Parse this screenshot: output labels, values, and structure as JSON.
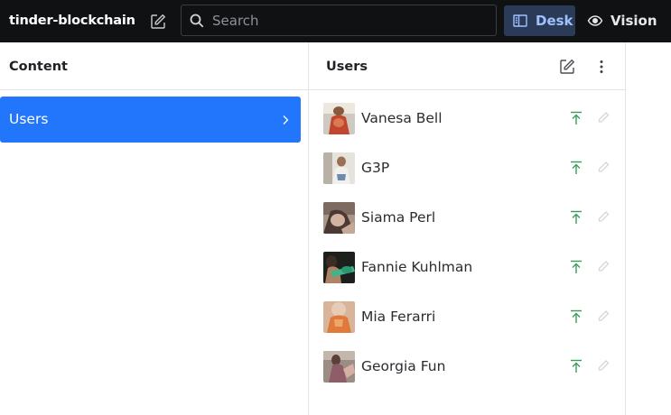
{
  "navbar": {
    "brand": "tinder-blockchain",
    "search": {
      "placeholder": "Search",
      "value": ""
    },
    "tools": [
      {
        "label": "Desk",
        "icon": "desk-panel-icon",
        "active": true
      },
      {
        "label": "Vision",
        "icon": "eye-icon",
        "active": false
      }
    ]
  },
  "content_pane": {
    "title": "Content",
    "items": [
      {
        "label": "Users",
        "selected": true
      }
    ]
  },
  "users_pane": {
    "title": "Users",
    "actions": [
      "compose-icon",
      "more-vertical-icon"
    ],
    "users": [
      {
        "name": "Vanesa Bell"
      },
      {
        "name": "G3P"
      },
      {
        "name": "Siama Perl"
      },
      {
        "name": "Fannie Kuhlman"
      },
      {
        "name": "Mia Ferarri"
      },
      {
        "name": "Georgia Fun"
      }
    ]
  },
  "colors": {
    "navbar_bg": "#101112",
    "accent": "#2276fc",
    "desk_active_bg": "#2a3a57",
    "desk_active_text": "#9fc1ff",
    "published_green": "#3a9c5a",
    "border": "#e2e4e8"
  }
}
